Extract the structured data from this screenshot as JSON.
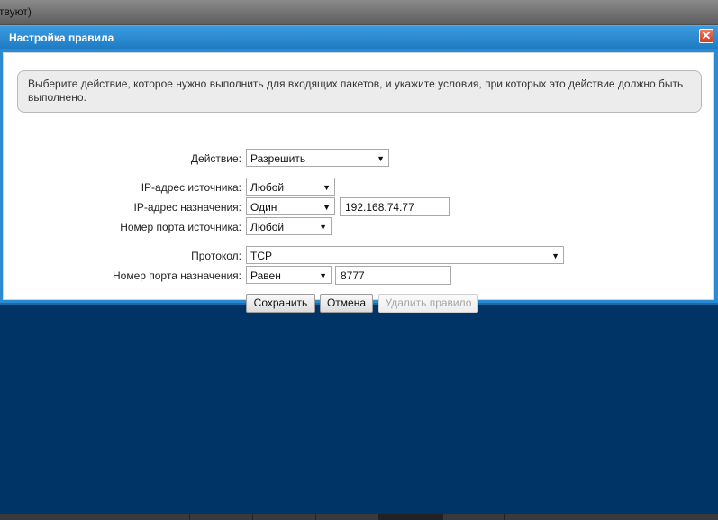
{
  "background_text": "твуют)",
  "dialog": {
    "title": "Настройка правила",
    "close_label": "✕",
    "info_text": "Выберите действие, которое нужно выполнить для входящих пакетов, и укажите условия, при которых это действие должно быть выполнено.",
    "fields": {
      "action": {
        "label": "Действие:",
        "value": "Разрешить"
      },
      "src_ip": {
        "label": "IP-адрес источника:",
        "value": "Любой"
      },
      "dst_ip": {
        "label": "IP-адрес назначения:",
        "value": "Один",
        "address": "192.168.74.77"
      },
      "src_port": {
        "label": "Номер порта источника:",
        "value": "Любой"
      },
      "protocol": {
        "label": "Протокол:",
        "value": "TCP"
      },
      "dst_port": {
        "label": "Номер порта назначения:",
        "value": "Равен",
        "port": "8777"
      }
    },
    "buttons": {
      "save": "Сохранить",
      "cancel": "Отмена",
      "delete": "Удалить правило"
    }
  },
  "colors": {
    "page_background": "#003366",
    "dialog_header": "#2a8bd2",
    "close_button": "#d9442b"
  },
  "icons": {
    "close": "close-icon",
    "dropdown": "chevron-down-icon"
  }
}
